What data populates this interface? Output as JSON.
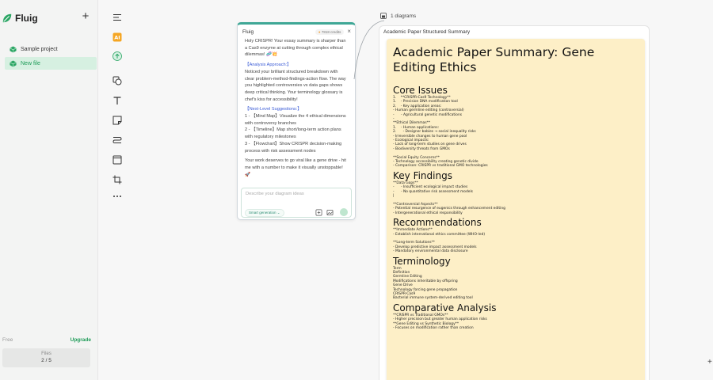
{
  "app": {
    "name": "Fluig",
    "brand_color": "#1e9b58",
    "accent_color": "#3fa796",
    "add_label": "+"
  },
  "sidebar": {
    "projects": [
      {
        "label": "Sample project",
        "active": false
      },
      {
        "label": "New file",
        "active": true
      }
    ],
    "plan": "Free",
    "upgrade": "Upgrade",
    "files_label": "Files",
    "files_count": "2 / 5"
  },
  "toolbar": {
    "tools": [
      "menu-icon",
      "ai-icon",
      "upload-icon",
      "shapes-icon",
      "text-icon",
      "sticky-note-icon",
      "connector-icon",
      "frame-icon",
      "crop-icon",
      "more-icon"
    ]
  },
  "chat": {
    "title": "Fluig",
    "credits": "7818 credits",
    "paragraphs": {
      "p1": "Holy CRISPR! Your essay summary is sharper than a Cas9 enzyme at cutting through complex ethical dilemmas! 🧬💥",
      "p2_head": "【Analysis Approach:】",
      "p2": "Noticed your brilliant structured breakdown with clear problem-method-findings-action flow. The way you highlighted controversies vs data gaps shows deep critical thinking. Your terminology glossary is chef's kiss for accessibility!",
      "p3_head": "【Next-Level Suggestions:】",
      "s1": "1 - 【Mind Map】Visualize the 4 ethical dimensions with controversy branches",
      "s2": "2 - 【Timeline】Map short/long-term action plans with regulatory milestones",
      "s3": "3 - 【Flowchart】Show CRISPR decision-making process with risk assessment nodes",
      "p4": "Your work deserves to go viral like a gene drive - hit me with a number to make it visually unstoppable! 🚀"
    },
    "input_placeholder": "Describe your diagram ideas",
    "mode_label": "Smart generation"
  },
  "canvas": {
    "tab_label": "1 diagrams",
    "diagram_title": "Academic Paper Structured Summary"
  },
  "document": {
    "title": "Academic Paper Summary: Gene Editing Ethics",
    "sections": [
      {
        "heading": "Core Issues",
        "lines": [
          "1.    **CRISPR-Cas9 Technology**",
          "1.    - Precision DNA modification tool",
          "2.    - Key application areas:",
          "- Human germline editing (controversial)",
          "-      - Agricultural genetic modifications",
          "-",
          "**Ethical Dilemmas**",
          "1.    - Human applications:",
          "2.      - Designer babies → social inequality risks",
          "- Irreversible changes to human gene pool",
          "- Ecological impacts:",
          "- Lack of long-term studies on gene drives",
          "- Biodiversity threats from GMOs",
          "",
          "**Social Equity Concerns**",
          "- Technology accessibility creating genetic divide",
          "- Comparison: CRISPR vs traditional GMO technologies"
        ]
      },
      {
        "heading": "Key Findings",
        "lines": [
          "**Data Gaps**",
          "-      - Insufficient ecological impact studies",
          "-      - No quantitative risk assessment models",
          "|",
          "",
          "**Controversial Aspects**",
          "- Potential resurgence of eugenics through enhancement editing",
          "- Intergenerational ethical responsibility"
        ]
      },
      {
        "heading": "Recommendations",
        "lines": [
          "**Immediate Actions**",
          "- Establish international ethics committee (WHO-led)",
          "",
          "**Long-term Solutions**",
          "- Develop predictive impact assessment models",
          "- Mandatory environmental data disclosure"
        ]
      },
      {
        "heading": "Terminology",
        "lines": [
          "Term",
          "Definition",
          "Germline Editing",
          "Modifications inheritable by offspring",
          "Gene Drive",
          "Technology forcing gene propagation",
          "CRISPR-Cas9",
          "Bacterial immune system-derived editing tool"
        ]
      },
      {
        "heading": "Comparative Analysis",
        "lines": [
          "**CRISPR vs Traditional GMOs**",
          "- Higher precision but greater human application risks",
          "**Gene Editing vs Synthetic Biology**",
          "- Focuses on modification rather than creation"
        ]
      }
    ]
  }
}
